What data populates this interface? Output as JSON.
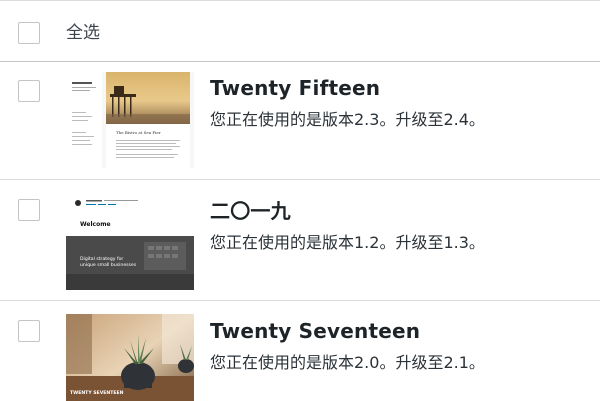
{
  "select_all": {
    "label": "全选"
  },
  "themes": [
    {
      "name": "Twenty Fifteen",
      "status": "您正在使用的是版本2.3。升级至2.4。",
      "thumbnail": {
        "site_title": "Twenty Fifteen",
        "post_title": "The Bistro at Sea Pier"
      }
    },
    {
      "name": "二〇一九",
      "status": "您正在使用的是版本1.2。升级至1.3。",
      "thumbnail": {
        "site_title": "Twenty Nineteen",
        "heading": "Welcome",
        "tagline": "Digital strategy for unique small businesses"
      }
    },
    {
      "name": "Twenty Seventeen",
      "status": "您正在使用的是版本2.0。升级至2.1。",
      "thumbnail": {
        "site_title": "TWENTY SEVENTEEN"
      }
    }
  ],
  "colors": {
    "border": "#c3c4c7",
    "title": "#1d2327",
    "text": "#2c3338"
  }
}
